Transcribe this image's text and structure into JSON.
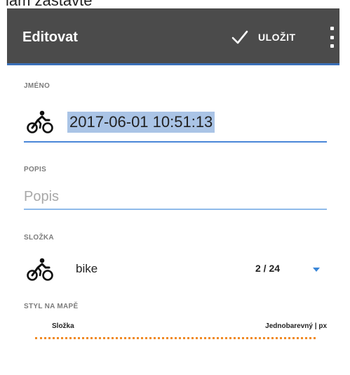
{
  "top_fragment": "lám zastavte",
  "appbar": {
    "title": "Editovat",
    "save_label": "ULOŽIT",
    "save_icon": "check-icon",
    "more_icon": "more-vert-icon"
  },
  "form": {
    "name": {
      "label": "JMÉNO",
      "value": "2017-06-01 10:51:13",
      "icon": "bike-icon"
    },
    "description": {
      "label": "POPIS",
      "placeholder": "Popis",
      "value": ""
    },
    "folder": {
      "label": "SLOŽKA",
      "value": "bike",
      "count": "2 / 24",
      "icon": "bike-icon"
    },
    "map_style": {
      "label": "STYL NA MAPĚ",
      "left": "Složka",
      "right": "Jednobarevný | px",
      "line_color": "#f08a24"
    }
  },
  "colors": {
    "appbar": "#4b4b4b",
    "accent": "#3a86d8",
    "selection": "#aac4e6"
  }
}
